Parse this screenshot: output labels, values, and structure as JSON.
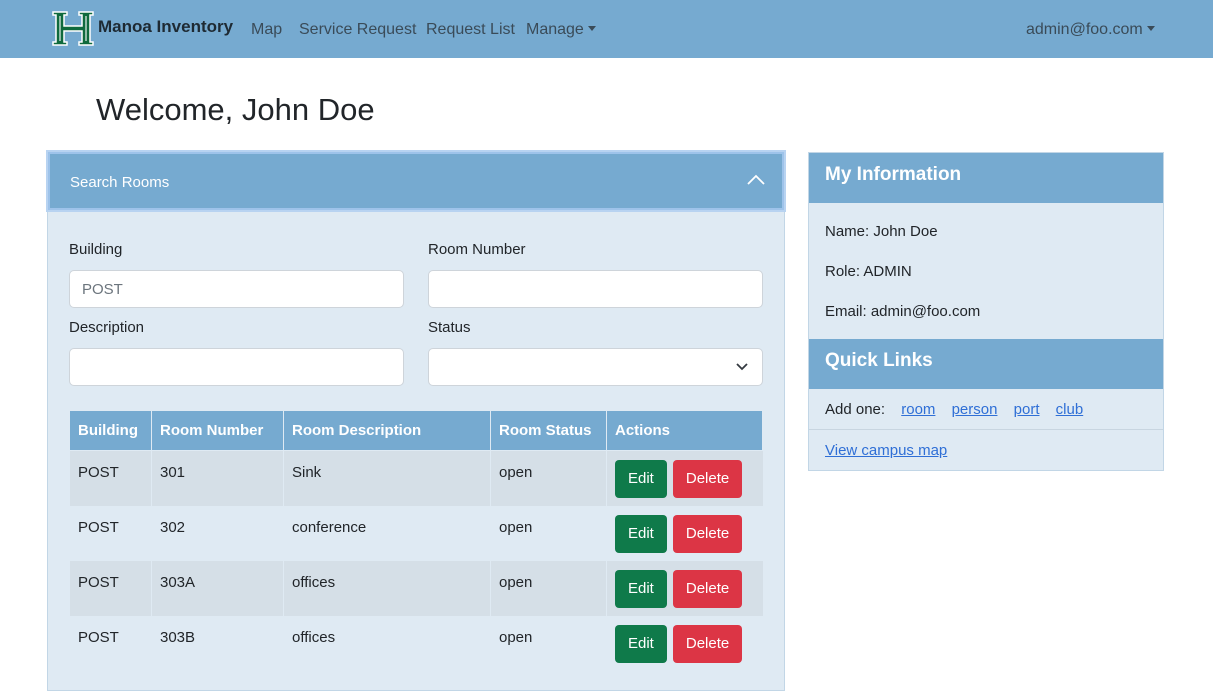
{
  "navbar": {
    "brand": "Manoa Inventory",
    "links": [
      "Map",
      "Service Request",
      "Request List",
      "Manage"
    ],
    "user": "admin@foo.com",
    "colors": {
      "bar": "#76aad0",
      "logo": "#0f6a3d"
    }
  },
  "page": {
    "welcome": "Welcome, John Doe"
  },
  "search": {
    "header": "Search Rooms",
    "building_label": "Building",
    "building_placeholder": "POST",
    "room_label": "Room Number",
    "description_label": "Description",
    "status_label": "Status",
    "status_value": ""
  },
  "table": {
    "headers": [
      "Building",
      "Room Number",
      "Room Description",
      "Room Status",
      "Actions"
    ],
    "rows": [
      {
        "building": "POST",
        "room": "301",
        "description": "Sink",
        "status": "open"
      },
      {
        "building": "POST",
        "room": "302",
        "description": "conference",
        "status": "open"
      },
      {
        "building": "POST",
        "room": "303A",
        "description": "offices",
        "status": "open"
      },
      {
        "building": "POST",
        "room": "303B",
        "description": "offices",
        "status": "open"
      }
    ],
    "edit_label": "Edit",
    "delete_label": "Delete",
    "colors": {
      "edit": "#0f7a4a",
      "delete": "#dc3545"
    }
  },
  "info": {
    "header": "My Information",
    "name": "Name: John Doe",
    "role": "Role: ADMIN",
    "email": "Email: admin@foo.com"
  },
  "quick_links": {
    "header": "Quick Links",
    "add_one": "Add one:",
    "items": [
      "room",
      "person",
      "port",
      "club"
    ],
    "map_link": "View campus map"
  }
}
